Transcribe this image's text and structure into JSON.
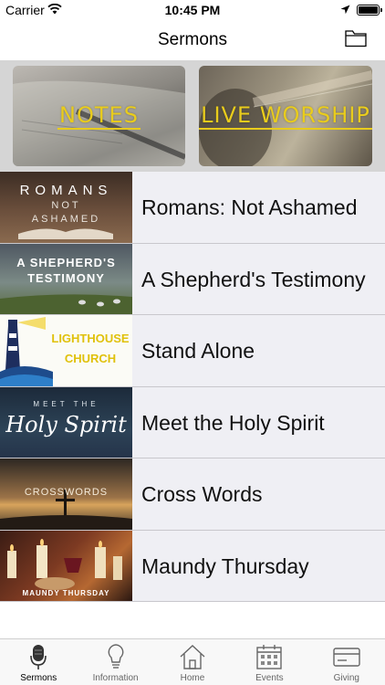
{
  "status_bar": {
    "carrier": "Carrier",
    "time": "10:45 PM"
  },
  "nav": {
    "title": "Sermons"
  },
  "banners": [
    {
      "label": "NOTES"
    },
    {
      "label": "LIVE WORSHIP"
    }
  ],
  "sermons": [
    {
      "title": "Romans: Not Ashamed",
      "thumb": [
        "ROMANS",
        "NOT",
        "ASHAMED"
      ]
    },
    {
      "title": "A Shepherd's Testimony",
      "thumb": [
        "A SHEPHERD'S",
        "TESTIMONY"
      ]
    },
    {
      "title": "Stand Alone",
      "thumb": [
        "LIGHTHOUSE",
        "CHURCH"
      ]
    },
    {
      "title": "Meet the Holy Spirit",
      "thumb": [
        "MEET THE",
        "Holy Spirit"
      ]
    },
    {
      "title": "Cross Words",
      "thumb": [
        "CROSSWORDS"
      ]
    },
    {
      "title": "Maundy Thursday",
      "thumb": [
        "MAUNDY THURSDAY"
      ]
    }
  ],
  "tabs": [
    {
      "label": "Sermons",
      "icon": "microphone-icon",
      "active": true
    },
    {
      "label": "Information",
      "icon": "lightbulb-icon"
    },
    {
      "label": "Home",
      "icon": "home-icon"
    },
    {
      "label": "Events",
      "icon": "calendar-icon"
    },
    {
      "label": "Giving",
      "icon": "credit-card-icon"
    }
  ],
  "colors": {
    "banner_text": "#e9cc1c",
    "list_bg": "#efeff4",
    "separator": "#c8c7cc"
  }
}
